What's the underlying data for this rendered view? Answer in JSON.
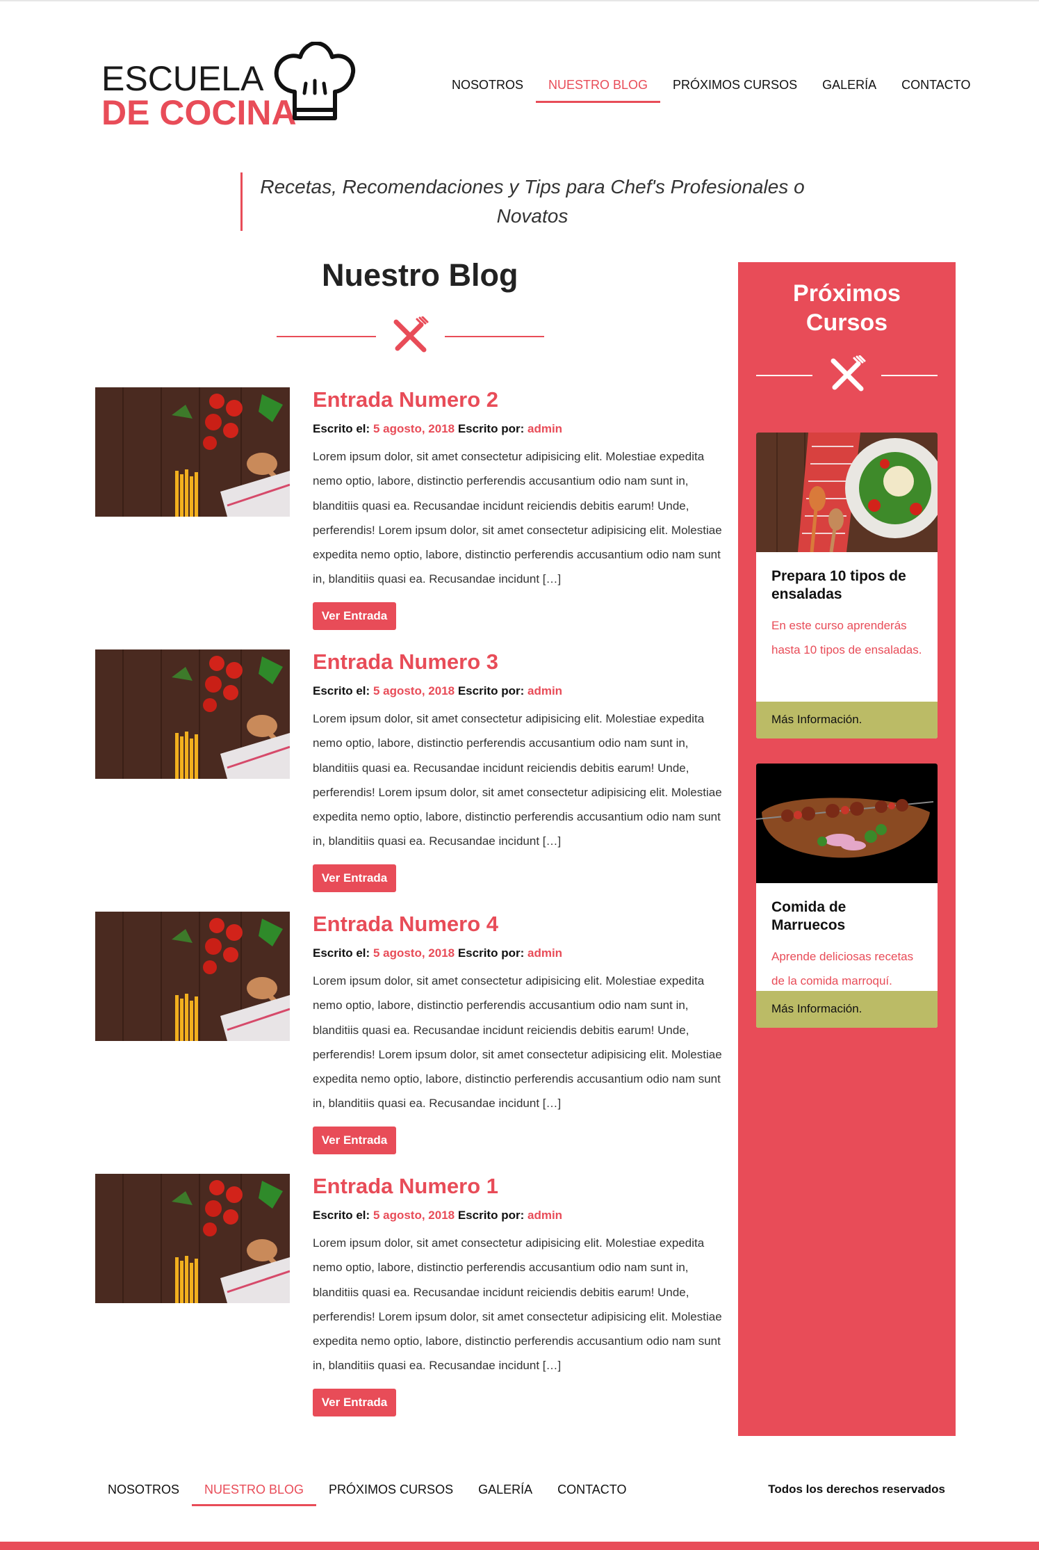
{
  "logo": {
    "line1": "ESCUELA",
    "line2": "DE COCINA",
    "icon": "chef-hat-icon"
  },
  "nav": {
    "items": [
      {
        "label": "NOSOTROS"
      },
      {
        "label": "NUESTRO BLOG",
        "active": true
      },
      {
        "label": "PRÓXIMOS CURSOS"
      },
      {
        "label": "GALERÍA"
      },
      {
        "label": "CONTACTO"
      }
    ]
  },
  "tagline": "Recetas, Recomendaciones y Tips para Chef's Profesionales o Novatos",
  "blog": {
    "heading": "Nuestro Blog",
    "divider_icon": "fork-knife-icon",
    "entries": [
      {
        "title": "Entrada Numero 2",
        "written_label": "Escrito el:",
        "date": "5 agosto, 2018",
        "author_label": "Escrito por:",
        "author": "admin",
        "excerpt": "Lorem ipsum dolor, sit amet consectetur adipisicing elit. Molestiae expedita nemo optio, labore, distinctio perferendis accusantium odio nam sunt in, blanditiis quasi ea. Recusandae incidunt reiciendis debitis earum! Unde, perferendis! Lorem ipsum dolor, sit amet consectetur adipisicing elit. Molestiae expedita nemo optio, labore, distinctio perferendis accusantium odio nam sunt in, blanditiis quasi ea. Recusandae incidunt […]",
        "button": "Ver Entrada"
      },
      {
        "title": "Entrada Numero 3",
        "written_label": "Escrito el:",
        "date": "5 agosto, 2018",
        "author_label": "Escrito por:",
        "author": "admin",
        "excerpt": "Lorem ipsum dolor, sit amet consectetur adipisicing elit. Molestiae expedita nemo optio, labore, distinctio perferendis accusantium odio nam sunt in, blanditiis quasi ea. Recusandae incidunt reiciendis debitis earum! Unde, perferendis! Lorem ipsum dolor, sit amet consectetur adipisicing elit. Molestiae expedita nemo optio, labore, distinctio perferendis accusantium odio nam sunt in, blanditiis quasi ea. Recusandae incidunt […]",
        "button": "Ver Entrada"
      },
      {
        "title": "Entrada Numero 4",
        "written_label": "Escrito el:",
        "date": "5 agosto, 2018",
        "author_label": "Escrito por:",
        "author": "admin",
        "excerpt": "Lorem ipsum dolor, sit amet consectetur adipisicing elit. Molestiae expedita nemo optio, labore, distinctio perferendis accusantium odio nam sunt in, blanditiis quasi ea. Recusandae incidunt reiciendis debitis earum! Unde, perferendis! Lorem ipsum dolor, sit amet consectetur adipisicing elit. Molestiae expedita nemo optio, labore, distinctio perferendis accusantium odio nam sunt in, blanditiis quasi ea. Recusandae incidunt […]",
        "button": "Ver Entrada"
      },
      {
        "title": "Entrada Numero 1",
        "written_label": "Escrito el:",
        "date": "5 agosto, 2018",
        "author_label": "Escrito por:",
        "author": "admin",
        "excerpt": "Lorem ipsum dolor, sit amet consectetur adipisicing elit. Molestiae expedita nemo optio, labore, distinctio perferendis accusantium odio nam sunt in, blanditiis quasi ea. Recusandae incidunt reiciendis debitis earum! Unde, perferendis! Lorem ipsum dolor, sit amet consectetur adipisicing elit. Molestiae expedita nemo optio, labore, distinctio perferendis accusantium odio nam sunt in, blanditiis quasi ea. Recusandae incidunt […]",
        "button": "Ver Entrada"
      }
    ]
  },
  "sidebar": {
    "title": "Próximos Cursos",
    "divider_icon": "fork-knife-icon",
    "courses": [
      {
        "title": "Prepara 10 tipos de ensaladas",
        "description": "En este curso aprenderás hasta 10 tipos de ensaladas.",
        "button": "Más Información."
      },
      {
        "title": "Comida de Marruecos",
        "description": "Aprende deliciosas recetas de la comida marroquí.",
        "button": "Más Información."
      }
    ]
  },
  "footer": {
    "nav": [
      {
        "label": "NOSOTROS"
      },
      {
        "label": "NUESTRO BLOG",
        "active": true
      },
      {
        "label": "PRÓXIMOS CURSOS"
      },
      {
        "label": "GALERÍA"
      },
      {
        "label": "CONTACTO"
      }
    ],
    "copyright": "Todos los derechos reservados"
  },
  "colors": {
    "accent": "#e84c58",
    "course_button": "#bbbb66"
  }
}
